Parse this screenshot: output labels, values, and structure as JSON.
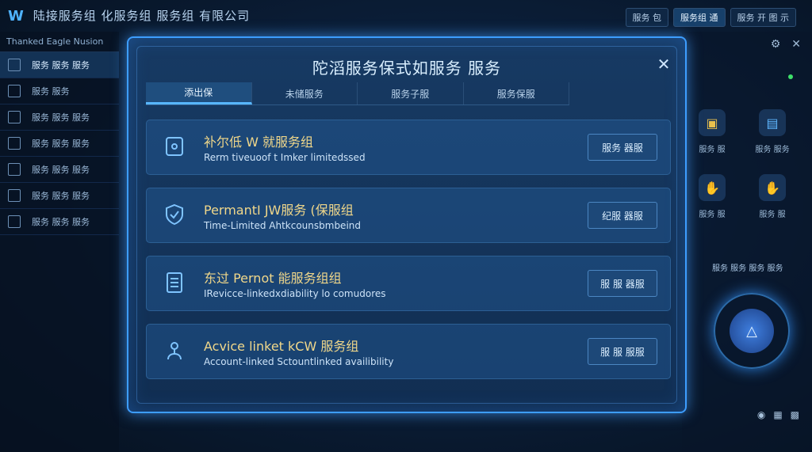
{
  "app": {
    "title": "陆接服务组 化服务组  服务组 有限公司"
  },
  "top_tabs": [
    "服务 包",
    "服务组 通",
    "服务 开 图 示"
  ],
  "sidebar": {
    "header": "Thanked Eagle Nusion",
    "items": [
      "服务 服务 服务",
      "服务 服务",
      "服务 服务 服务",
      "服务 服务 服务",
      "服务 服务 服务",
      "服务 服务 服务",
      "服务 服务 服务"
    ]
  },
  "modal": {
    "title": "陀滔服务保式如服务 服务",
    "close_label": "✕",
    "tabs": [
      "添出保",
      "未储服务",
      "服务子服",
      "服务保服"
    ],
    "cards": [
      {
        "title": "补尔低 W 就服务组",
        "subtitle": "Rerm tiveuoof t Imker limitedssed",
        "button": "服务 器服"
      },
      {
        "title": "PermantI JW服务 (保服组",
        "subtitle": "Time-Limited Ahtkcounsbmbeind",
        "button": "纪服 器服"
      },
      {
        "title": "东过 Pernot 能服务组组",
        "subtitle": "IRevicce-linkedxdiability lo comudores",
        "button": "服 服 器服"
      },
      {
        "title": "Acvice linket kCW 服务组",
        "subtitle": "Account-linked Sctountlinked availibility",
        "button": "服 服 服服"
      }
    ]
  },
  "right_panel": {
    "tiles": [
      "服务 服",
      "服务 服务",
      "服务 服",
      "服务 服"
    ],
    "caption": "服务 服务 服务 服务"
  }
}
